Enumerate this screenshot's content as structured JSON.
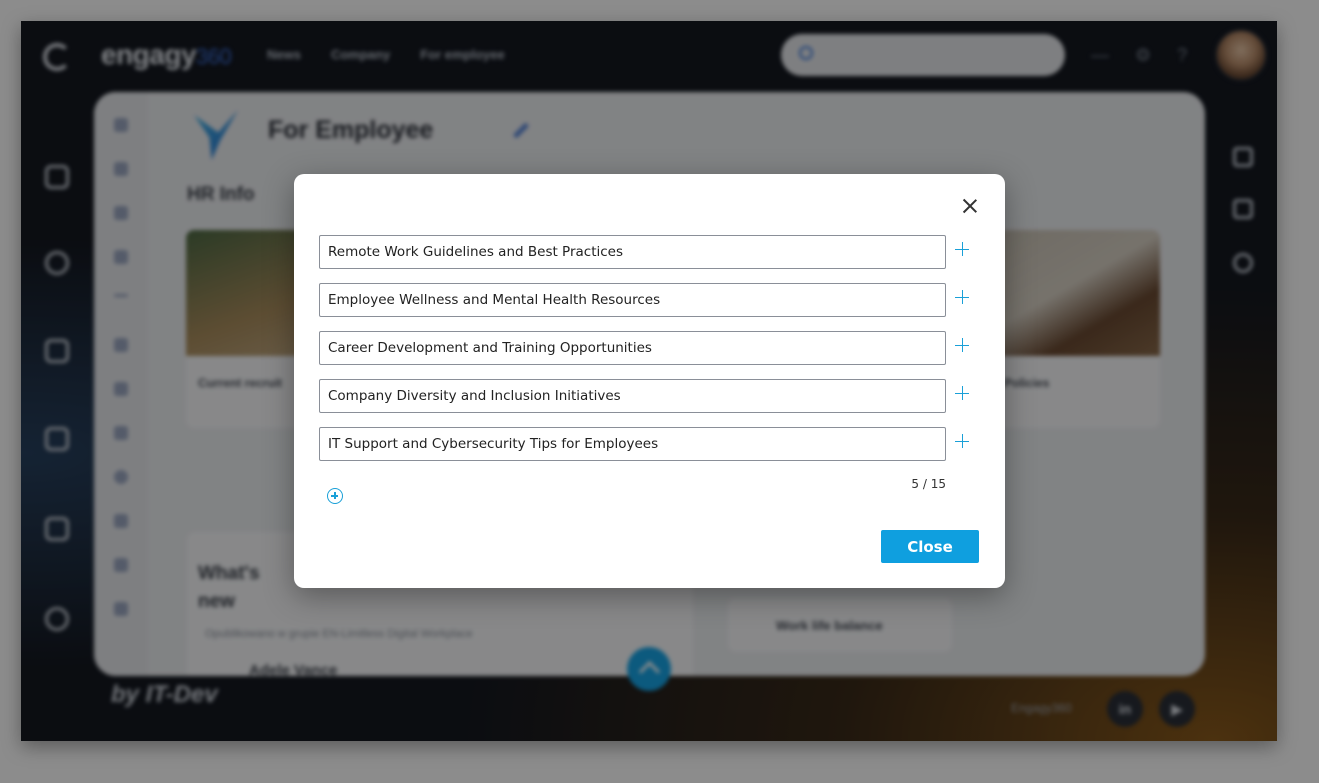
{
  "app": {
    "brand_name": "engagy",
    "brand_suffix": "360",
    "nav": [
      "News",
      "Company",
      "For employee"
    ],
    "footer_by": "by IT-Dev",
    "footer_engagy": "Engagy360",
    "footer_linkedin": "in",
    "footer_youtube": "▶"
  },
  "page": {
    "title": "For Employee",
    "section_title": "HR Info",
    "cards": [
      {
        "caption": "Current recruit"
      },
      {
        "caption": "Policies"
      }
    ],
    "whats_new": {
      "title": "What's new",
      "subtitle": "Opublikowano w grupie EN-Limitless Digital Workplace",
      "person": "Adele Vance"
    },
    "work_life_balance": "Work life balance"
  },
  "modal": {
    "items": [
      {
        "value": "Remote Work Guidelines and Best Practices"
      },
      {
        "value": "Employee Wellness and Mental Health Resources"
      },
      {
        "value": "Career Development and Training Opportunities"
      },
      {
        "value": "Company Diversity and Inclusion Initiatives"
      },
      {
        "value": "IT Support and Cybersecurity Tips for Employees"
      }
    ],
    "counter": "5 / 15",
    "close_label": "Close"
  },
  "colors": {
    "accent": "#0f9fdf",
    "overlay": "rgba(0,0,0,0.45)"
  }
}
